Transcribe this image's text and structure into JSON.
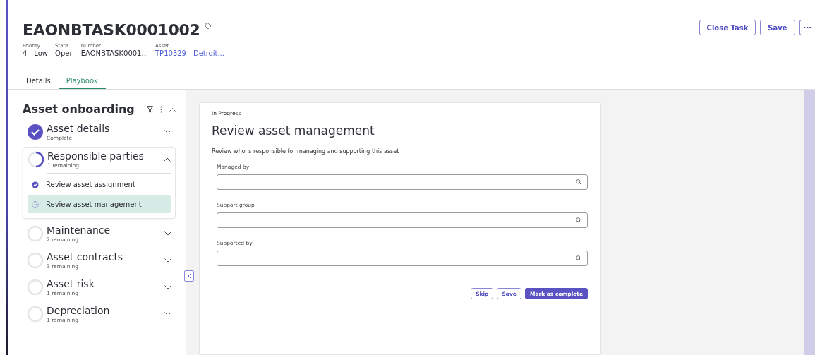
{
  "header": {
    "title": "EAONBTASK0001002",
    "actions": [
      "Close Task",
      "Save",
      "···"
    ],
    "fields": [
      {
        "label": "Priority",
        "value": "4 - Low",
        "link": false
      },
      {
        "label": "State",
        "value": "Open",
        "link": false
      },
      {
        "label": "Number",
        "value": "EAONBTASK0001...",
        "link": false
      },
      {
        "label": "Asset",
        "value": "TP10329 - Detroit...",
        "link": true
      }
    ]
  },
  "tabs": [
    {
      "label": "Details",
      "selected": false
    },
    {
      "label": "Playbook",
      "selected": true
    }
  ],
  "sidebar": {
    "title": "Asset onboarding",
    "stages": [
      {
        "name": "Asset details",
        "status": "Complete",
        "kind": "complete",
        "expanded": false
      },
      {
        "name": "Responsible parties",
        "status": "1 remaining",
        "kind": "partial",
        "expanded": true,
        "children": [
          {
            "name": "Review asset assignment",
            "complete": true,
            "selected": false
          },
          {
            "name": "Review asset management",
            "complete": false,
            "selected": true
          }
        ]
      },
      {
        "name": "Maintenance",
        "status": "2 remaining",
        "kind": "pending",
        "expanded": false
      },
      {
        "name": "Asset contracts",
        "status": "3 remaining",
        "kind": "pending",
        "expanded": false
      },
      {
        "name": "Asset risk",
        "status": "1 remaining",
        "kind": "pending",
        "expanded": false
      },
      {
        "name": "Depreciation",
        "status": "1 remaining",
        "kind": "pending",
        "expanded": false
      }
    ]
  },
  "card": {
    "state": "In Progress",
    "title": "Review asset management",
    "description": "Review who is responsible for managing and supporting this asset",
    "fields": [
      {
        "label": "Managed by"
      },
      {
        "label": "Support group"
      },
      {
        "label": "Supported by"
      }
    ],
    "buttons": [
      {
        "label": "Skip",
        "primary": false
      },
      {
        "label": "Save",
        "primary": false
      },
      {
        "label": "Mark as complete",
        "primary": true
      }
    ]
  }
}
